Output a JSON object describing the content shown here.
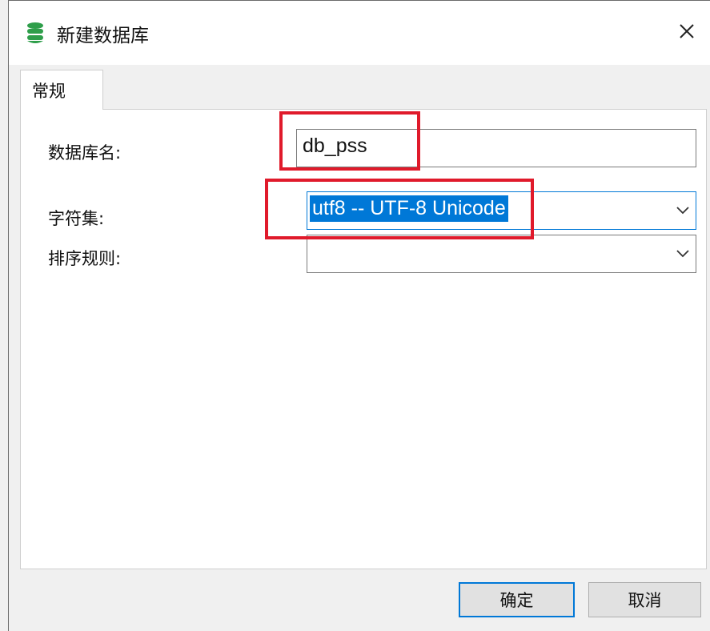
{
  "window": {
    "title": "新建数据库"
  },
  "tabs": [
    {
      "label": "常规",
      "active": true
    }
  ],
  "form": {
    "db_name_label": "数据库名:",
    "db_name_value": "db_pss",
    "charset_label": "字符集:",
    "charset_value": "utf8 -- UTF-8 Unicode",
    "collation_label": "排序规则:",
    "collation_value": ""
  },
  "buttons": {
    "ok": "确定",
    "cancel": "取消"
  },
  "icons": {
    "title": "database-icon",
    "close": "close-icon",
    "dropdown": "chevron-down-icon"
  },
  "colors": {
    "accent": "#0078d7",
    "annotation": "#e01a2b",
    "db_icon": "#2e9e4a"
  }
}
